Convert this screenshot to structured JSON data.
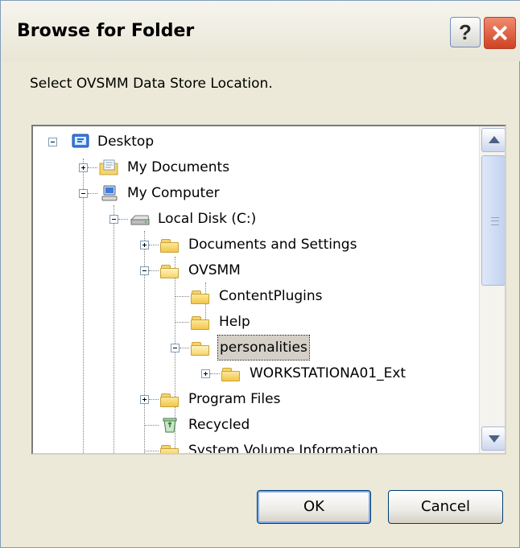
{
  "dialog": {
    "title": "Browse for Folder",
    "help_label": "?",
    "instructions": "Select OVSMM Data Store Location."
  },
  "tree": {
    "items": [
      {
        "label": "Desktop",
        "icon": "desktop-icon",
        "expander": "minus",
        "selected": false
      },
      {
        "label": "My Documents",
        "icon": "my-documents-icon",
        "expander": "plus",
        "selected": false
      },
      {
        "label": "My Computer",
        "icon": "my-computer-icon",
        "expander": "minus",
        "selected": false
      },
      {
        "label": "Local Disk (C:)",
        "icon": "hard-disk-icon",
        "expander": "minus",
        "selected": false
      },
      {
        "label": "Documents and Settings",
        "icon": "folder-icon",
        "expander": "plus",
        "selected": false
      },
      {
        "label": "OVSMM",
        "icon": "folder-icon",
        "expander": "minus",
        "selected": false
      },
      {
        "label": "ContentPlugins",
        "icon": "folder-icon",
        "expander": "none",
        "selected": false
      },
      {
        "label": "Help",
        "icon": "folder-icon",
        "expander": "none",
        "selected": false
      },
      {
        "label": "personalities",
        "icon": "folder-open-icon",
        "expander": "minus",
        "selected": true
      },
      {
        "label": "WORKSTATIONA01_Ext",
        "icon": "folder-icon",
        "expander": "plus",
        "selected": false
      },
      {
        "label": "Program Files",
        "icon": "folder-icon",
        "expander": "plus",
        "selected": false
      },
      {
        "label": "Recycled",
        "icon": "recycle-bin-icon",
        "expander": "none",
        "selected": false
      },
      {
        "label": "System Volume Information",
        "icon": "folder-icon",
        "expander": "none",
        "selected": false
      }
    ]
  },
  "buttons": {
    "ok_label": "OK",
    "cancel_label": "Cancel"
  },
  "colors": {
    "dialog_background": "#ece9d8",
    "selection_background": "#d4d0c8",
    "close_button": "#cf4124"
  }
}
